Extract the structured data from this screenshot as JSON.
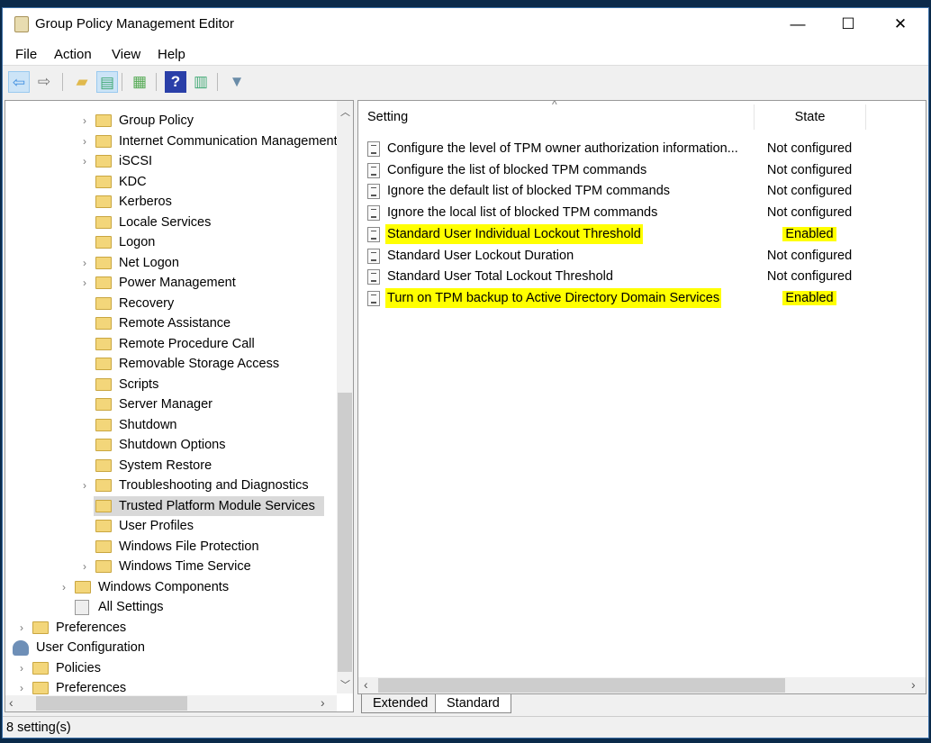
{
  "window": {
    "title": "Group Policy Management Editor",
    "minimize": "—",
    "maximize": "☐",
    "close": "✕"
  },
  "menu": [
    "File",
    "Action",
    "View",
    "Help"
  ],
  "toolbar": [
    {
      "name": "back-icon",
      "glyph": "⇦",
      "color": "#3d8ee0"
    },
    {
      "name": "forward-icon",
      "glyph": "⇨",
      "color": "#777"
    },
    {
      "name": "up-folder-icon",
      "glyph": "▰",
      "color": "#e0b94d"
    },
    {
      "name": "show-hide-tree-icon",
      "glyph": "▤",
      "color": "#4a7"
    },
    {
      "name": "export-list-icon",
      "glyph": "▦",
      "color": "#5a5"
    },
    {
      "name": "help-icon",
      "glyph": "?",
      "color": "#2a3fa8"
    },
    {
      "name": "action-pane-icon",
      "glyph": "▥",
      "color": "#4a7"
    },
    {
      "name": "filter-icon",
      "glyph": "▼",
      "color": "#6a8ca8"
    }
  ],
  "tree": [
    {
      "label": "Group Policy",
      "depth": 3,
      "expandable": true,
      "icon": "folder"
    },
    {
      "label": "Internet Communication Management",
      "depth": 3,
      "expandable": true,
      "icon": "folder"
    },
    {
      "label": "iSCSI",
      "depth": 3,
      "expandable": true,
      "icon": "folder"
    },
    {
      "label": "KDC",
      "depth": 3,
      "expandable": false,
      "icon": "folder"
    },
    {
      "label": "Kerberos",
      "depth": 3,
      "expandable": false,
      "icon": "folder"
    },
    {
      "label": "Locale Services",
      "depth": 3,
      "expandable": false,
      "icon": "folder"
    },
    {
      "label": "Logon",
      "depth": 3,
      "expandable": false,
      "icon": "folder"
    },
    {
      "label": "Net Logon",
      "depth": 3,
      "expandable": true,
      "icon": "folder"
    },
    {
      "label": "Power Management",
      "depth": 3,
      "expandable": true,
      "icon": "folder"
    },
    {
      "label": "Recovery",
      "depth": 3,
      "expandable": false,
      "icon": "folder"
    },
    {
      "label": "Remote Assistance",
      "depth": 3,
      "expandable": false,
      "icon": "folder"
    },
    {
      "label": "Remote Procedure Call",
      "depth": 3,
      "expandable": false,
      "icon": "folder"
    },
    {
      "label": "Removable Storage Access",
      "depth": 3,
      "expandable": false,
      "icon": "folder"
    },
    {
      "label": "Scripts",
      "depth": 3,
      "expandable": false,
      "icon": "folder"
    },
    {
      "label": "Server Manager",
      "depth": 3,
      "expandable": false,
      "icon": "folder"
    },
    {
      "label": "Shutdown",
      "depth": 3,
      "expandable": false,
      "icon": "folder"
    },
    {
      "label": "Shutdown Options",
      "depth": 3,
      "expandable": false,
      "icon": "folder"
    },
    {
      "label": "System Restore",
      "depth": 3,
      "expandable": false,
      "icon": "folder"
    },
    {
      "label": "Troubleshooting and Diagnostics",
      "depth": 3,
      "expandable": true,
      "icon": "folder"
    },
    {
      "label": "Trusted Platform Module Services",
      "depth": 3,
      "expandable": false,
      "icon": "folder",
      "selected": true
    },
    {
      "label": "User Profiles",
      "depth": 3,
      "expandable": false,
      "icon": "folder"
    },
    {
      "label": "Windows File Protection",
      "depth": 3,
      "expandable": false,
      "icon": "folder"
    },
    {
      "label": "Windows Time Service",
      "depth": 3,
      "expandable": true,
      "icon": "folder"
    },
    {
      "label": "Windows Components",
      "depth": 2,
      "expandable": true,
      "icon": "folder"
    },
    {
      "label": "All Settings",
      "depth": 2,
      "expandable": false,
      "icon": "all-settings"
    },
    {
      "label": "Preferences",
      "depth": 0,
      "expandable": true,
      "icon": "folder"
    },
    {
      "label": "User Configuration",
      "depth": -1,
      "expandable": false,
      "icon": "user"
    },
    {
      "label": "Policies",
      "depth": 0,
      "expandable": true,
      "icon": "folder"
    },
    {
      "label": "Preferences",
      "depth": 0,
      "expandable": true,
      "icon": "folder"
    }
  ],
  "list": {
    "columns": [
      "Setting",
      "State"
    ],
    "highlight_color": "#ffff00",
    "rows": [
      {
        "setting": "Configure the level of TPM owner authorization information...",
        "state": "Not configured"
      },
      {
        "setting": "Configure the list of blocked TPM commands",
        "state": "Not configured"
      },
      {
        "setting": "Ignore the default list of blocked TPM commands",
        "state": "Not configured"
      },
      {
        "setting": "Ignore the local list of blocked TPM commands",
        "state": "Not configured"
      },
      {
        "setting": "Standard User Individual Lockout Threshold",
        "state": "Enabled",
        "highlighted": true
      },
      {
        "setting": "Standard User Lockout Duration",
        "state": "Not configured"
      },
      {
        "setting": "Standard User Total Lockout Threshold",
        "state": "Not configured"
      },
      {
        "setting": "Turn on TPM backup to Active Directory Domain Services",
        "state": "Enabled",
        "highlighted": true
      }
    ]
  },
  "tabs": [
    "Extended",
    "Standard"
  ],
  "active_tab": "Standard",
  "status": "8 setting(s)"
}
